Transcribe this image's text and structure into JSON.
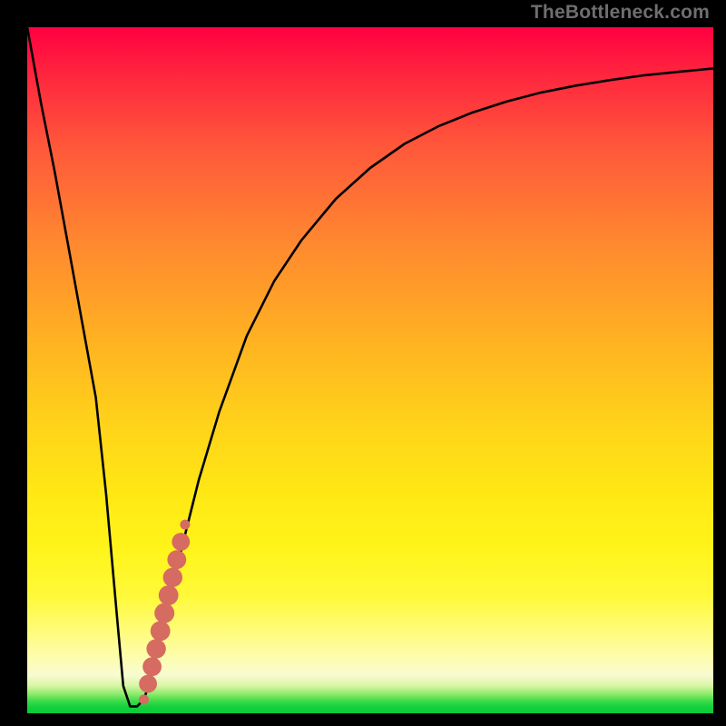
{
  "watermark": "TheBottleneck.com",
  "colors": {
    "frame": "#000000",
    "curve": "#000000",
    "marker": "#d66b61",
    "gradient_stops": [
      "#ff0040",
      "#ff2b3e",
      "#ff5a3a",
      "#ff8a2f",
      "#ffb321",
      "#ffd31a",
      "#ffe814",
      "#fff41a",
      "#fff93a",
      "#fffc7a",
      "#fdfdb0",
      "#f8fbd0",
      "#d7f6a4",
      "#8eea6a",
      "#3ddc4b",
      "#16d13d",
      "#0ac93a"
    ]
  },
  "chart_data": {
    "type": "line",
    "title": "",
    "xlabel": "",
    "ylabel": "",
    "xlim": [
      0,
      100
    ],
    "ylim": [
      0,
      100
    ],
    "series": [
      {
        "name": "bottleneck-curve",
        "x": [
          0,
          2,
          4,
          6,
          8,
          10,
          11.5,
          13,
          14,
          15,
          16,
          17,
          18,
          20,
          22,
          25,
          28,
          32,
          36,
          40,
          45,
          50,
          55,
          60,
          65,
          70,
          75,
          80,
          85,
          90,
          95,
          100
        ],
        "y": [
          100,
          89,
          79,
          68,
          57,
          46,
          32,
          15,
          4,
          1,
          1,
          2,
          5,
          13,
          22,
          34,
          44,
          55,
          63,
          69,
          75,
          79.5,
          83,
          85.6,
          87.6,
          89.2,
          90.5,
          91.5,
          92.3,
          93,
          93.5,
          94
        ]
      }
    ],
    "markers": {
      "name": "highlight-segment",
      "x": [
        17.0,
        17.6,
        18.2,
        18.8,
        19.4,
        20.0,
        20.6,
        21.2,
        21.8,
        22.4,
        23.0
      ],
      "y": [
        2.0,
        4.3,
        6.8,
        9.4,
        12.0,
        14.6,
        17.2,
        19.8,
        22.4,
        25.0,
        27.5
      ]
    }
  }
}
